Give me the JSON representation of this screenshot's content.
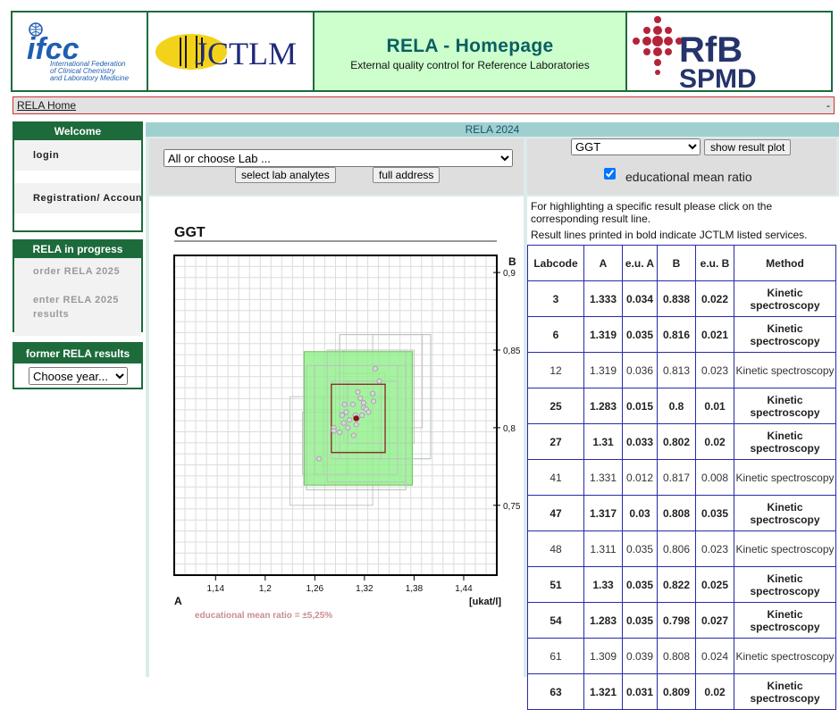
{
  "header": {
    "ifcc_logo_text": "ifcc",
    "ifcc_org_lines": [
      "International Federation",
      "of Clinical Chemistry",
      "and Laboratory Medicine"
    ],
    "jctlm_logo_text": "JCTLM",
    "title": "RELA - Homepage",
    "subtitle": "External quality control for Reference Laboratories",
    "rfb_logo_text": "RfB",
    "spmd_logo_text": "SPMD"
  },
  "nav": {
    "home_label": "RELA Home",
    "right_text": "-"
  },
  "sidebar": {
    "welcome": {
      "title": "Welcome",
      "items": [
        "login",
        "Registration/ Account"
      ]
    },
    "progress": {
      "title": "RELA in progress",
      "items": [
        "order RELA 2025",
        "enter RELA 2025 results"
      ]
    },
    "former": {
      "title": "former RELA results",
      "select_value": "Choose year..."
    }
  },
  "main": {
    "bar_title": "RELA 2024",
    "lab_select": "All or choose Lab ...",
    "select_analytes_label": "select lab analytes",
    "full_address_label": "full address",
    "analyte_select": "GGT",
    "show_plot_label": "show result plot",
    "edu_checkbox_label": "educational mean ratio",
    "edu_checked": true,
    "info_line1": "For highlighting a specific result please click on the",
    "info_line2": "corresponding result line.",
    "info_line3": "Result lines printed in bold indicate JCTLM listed services."
  },
  "plot": {
    "title": "GGT",
    "label_a": "A",
    "label_b": "B",
    "unit": "[ukat/l]",
    "footnote": "educational mean ratio = ±5,25%",
    "x_ticks": [
      "1,14",
      "1,2",
      "1,26",
      "1,32",
      "1,38",
      "1,44"
    ],
    "y_ticks": [
      "0,9",
      "0,85",
      "0,8",
      "0,75"
    ]
  },
  "chart_data": {
    "type": "scatter",
    "title": "GGT",
    "xlabel": "A",
    "ylabel": "B",
    "unit": "[ukat/l]",
    "xlim": [
      1.09,
      1.48
    ],
    "ylim": [
      0.705,
      0.911
    ],
    "grid": true,
    "mean_point": [
      1.31,
      0.806
    ],
    "edu_band": {
      "x": [
        1.247,
        1.378
      ],
      "y": [
        0.763,
        0.849
      ]
    },
    "inner_box": {
      "x": [
        1.28,
        1.345
      ],
      "y": [
        0.784,
        0.828
      ]
    },
    "points": [
      [
        1.333,
        0.838
      ],
      [
        1.319,
        0.816
      ],
      [
        1.319,
        0.813
      ],
      [
        1.283,
        0.8
      ],
      [
        1.31,
        0.802
      ],
      [
        1.331,
        0.817
      ],
      [
        1.317,
        0.808
      ],
      [
        1.311,
        0.806
      ],
      [
        1.33,
        0.822
      ],
      [
        1.283,
        0.798
      ],
      [
        1.309,
        0.808
      ],
      [
        1.298,
        0.81
      ],
      [
        1.302,
        0.805
      ],
      [
        1.295,
        0.803
      ],
      [
        1.306,
        0.815
      ],
      [
        1.322,
        0.812
      ],
      [
        1.29,
        0.797
      ],
      [
        1.3,
        0.8
      ],
      [
        1.315,
        0.819
      ],
      [
        1.325,
        0.81
      ],
      [
        1.293,
        0.808
      ],
      [
        1.307,
        0.795
      ],
      [
        1.296,
        0.815
      ],
      [
        1.265,
        0.78
      ],
      [
        1.338,
        0.83
      ],
      [
        1.312,
        0.823
      ]
    ],
    "uncertainty_boxes": [
      [
        1.26,
        1.36,
        0.77,
        0.84
      ],
      [
        1.28,
        1.34,
        0.78,
        0.83
      ],
      [
        1.275,
        1.37,
        0.765,
        0.85
      ],
      [
        1.29,
        1.4,
        0.78,
        0.86
      ],
      [
        1.3,
        1.36,
        0.79,
        0.83
      ],
      [
        1.25,
        1.37,
        0.76,
        0.84
      ],
      [
        1.33,
        1.39,
        0.8,
        0.86
      ],
      [
        1.27,
        1.35,
        0.77,
        0.82
      ],
      [
        1.23,
        1.33,
        0.75,
        0.82
      ],
      [
        1.285,
        1.345,
        0.785,
        0.835
      ],
      [
        1.295,
        1.38,
        0.79,
        0.85
      ],
      [
        1.245,
        1.3,
        0.77,
        0.81
      ]
    ]
  },
  "table": {
    "headers": [
      "Labcode",
      "A",
      "e.u. A",
      "B",
      "e.u. B",
      "Method"
    ],
    "rows": [
      {
        "bold": true,
        "cells": [
          "3",
          "1.333",
          "0.034",
          "0.838",
          "0.022",
          "Kinetic spectroscopy"
        ]
      },
      {
        "bold": true,
        "cells": [
          "6",
          "1.319",
          "0.035",
          "0.816",
          "0.021",
          "Kinetic spectroscopy"
        ]
      },
      {
        "bold": false,
        "cells": [
          "12",
          "1.319",
          "0.036",
          "0.813",
          "0.023",
          "Kinetic spectroscopy"
        ]
      },
      {
        "bold": true,
        "cells": [
          "25",
          "1.283",
          "0.015",
          "0.8",
          "0.01",
          "Kinetic spectroscopy"
        ]
      },
      {
        "bold": true,
        "cells": [
          "27",
          "1.31",
          "0.033",
          "0.802",
          "0.02",
          "Kinetic spectroscopy"
        ]
      },
      {
        "bold": false,
        "cells": [
          "41",
          "1.331",
          "0.012",
          "0.817",
          "0.008",
          "Kinetic spectroscopy"
        ]
      },
      {
        "bold": true,
        "cells": [
          "47",
          "1.317",
          "0.03",
          "0.808",
          "0.035",
          "Kinetic spectroscopy"
        ]
      },
      {
        "bold": false,
        "cells": [
          "48",
          "1.311",
          "0.035",
          "0.806",
          "0.023",
          "Kinetic spectroscopy"
        ]
      },
      {
        "bold": true,
        "cells": [
          "51",
          "1.33",
          "0.035",
          "0.822",
          "0.025",
          "Kinetic spectroscopy"
        ]
      },
      {
        "bold": true,
        "cells": [
          "54",
          "1.283",
          "0.035",
          "0.798",
          "0.027",
          "Kinetic spectroscopy"
        ]
      },
      {
        "bold": false,
        "cells": [
          "61",
          "1.309",
          "0.039",
          "0.808",
          "0.024",
          "Kinetic spectroscopy"
        ]
      },
      {
        "bold": true,
        "cells": [
          "63",
          "1.321",
          "0.031",
          "0.809",
          "0.02",
          "Kinetic spectroscopy"
        ]
      }
    ]
  },
  "colors": {
    "brand_green": "#1d6b3b",
    "title_teal": "#0b5f62",
    "header_bg": "#ccffcc",
    "rfb_red": "#b3243a",
    "spmd_navy": "#25346b",
    "band_green": "#8ff08a"
  }
}
